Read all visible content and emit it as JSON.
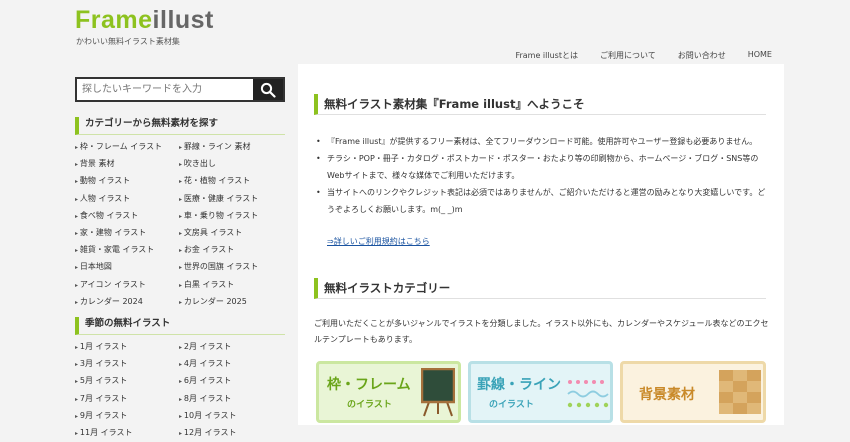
{
  "logo": {
    "part1": "Frame",
    "part2": "illust"
  },
  "tagline": "かわいい無料イラスト素材集",
  "nav": [
    "Frame illustとは",
    "ご利用について",
    "お問い合わせ",
    "HOME"
  ],
  "search": {
    "placeholder": "探したいキーワードを入力"
  },
  "sidebar": {
    "categories_title": "カテゴリーから無料素材を探す",
    "categories": [
      "枠・フレーム イラスト",
      "罫線・ライン 素材",
      "背景 素材",
      "吹き出し",
      "動物 イラスト",
      "花・植物 イラスト",
      "人物 イラスト",
      "医療・健康 イラスト",
      "食べ物 イラスト",
      "車・乗り物 イラスト",
      "家・建物 イラスト",
      "文房具 イラスト",
      "雑貨・家電 イラスト",
      "お金 イラスト",
      "日本地図",
      "世界の国旗 イラスト",
      "アイコン イラスト",
      "白黒 イラスト",
      "カレンダー 2024",
      "カレンダー 2025"
    ],
    "seasons_title": "季節の無料イラスト",
    "seasons": [
      "1月 イラスト",
      "2月 イラスト",
      "3月 イラスト",
      "4月 イラスト",
      "5月 イラスト",
      "6月 イラスト",
      "7月 イラスト",
      "8月 イラスト",
      "9月 イラスト",
      "10月 イラスト",
      "11月 イラスト",
      "12月 イラスト"
    ]
  },
  "main": {
    "welcome_title": "無料イラスト素材集『Frame illust』へようこそ",
    "intro": [
      "『Frame illust』が提供するフリー素材は、全てフリーダウンロード可能。使用許可やユーザー登録も必要ありません。",
      "チラシ・POP・冊子・カタログ・ポストカード・ポスター・おたより等の印刷物から、ホームページ・ブログ・SNS等のWebサイトまで、様々な媒体でご利用いただけます。",
      "当サイトへのリンクやクレジット表記は必須ではありませんが、ご紹介いただけると運営の励みとなり大変嬉しいです。どうぞよろしくお願いします。m(_ _)m"
    ],
    "terms_link": "⇒詳しいご利用規約はこちら",
    "category_title": "無料イラストカテゴリー",
    "category_desc": "ご利用いただくことが多いジャンルでイラストを分類しました。イラスト以外にも、カレンダーやスケジュール表などのエクセルテンプレートもあります。",
    "banners": [
      {
        "title": "枠・フレーム",
        "sub": "のイラスト"
      },
      {
        "title": "罫線・ライン",
        "sub": "のイラスト"
      },
      {
        "title": "背景素材"
      }
    ]
  },
  "colors": {
    "accent": "#8dc21f",
    "banner1": "#6aa51a",
    "banner2": "#3aa3b8",
    "banner3": "#c98a2a"
  }
}
